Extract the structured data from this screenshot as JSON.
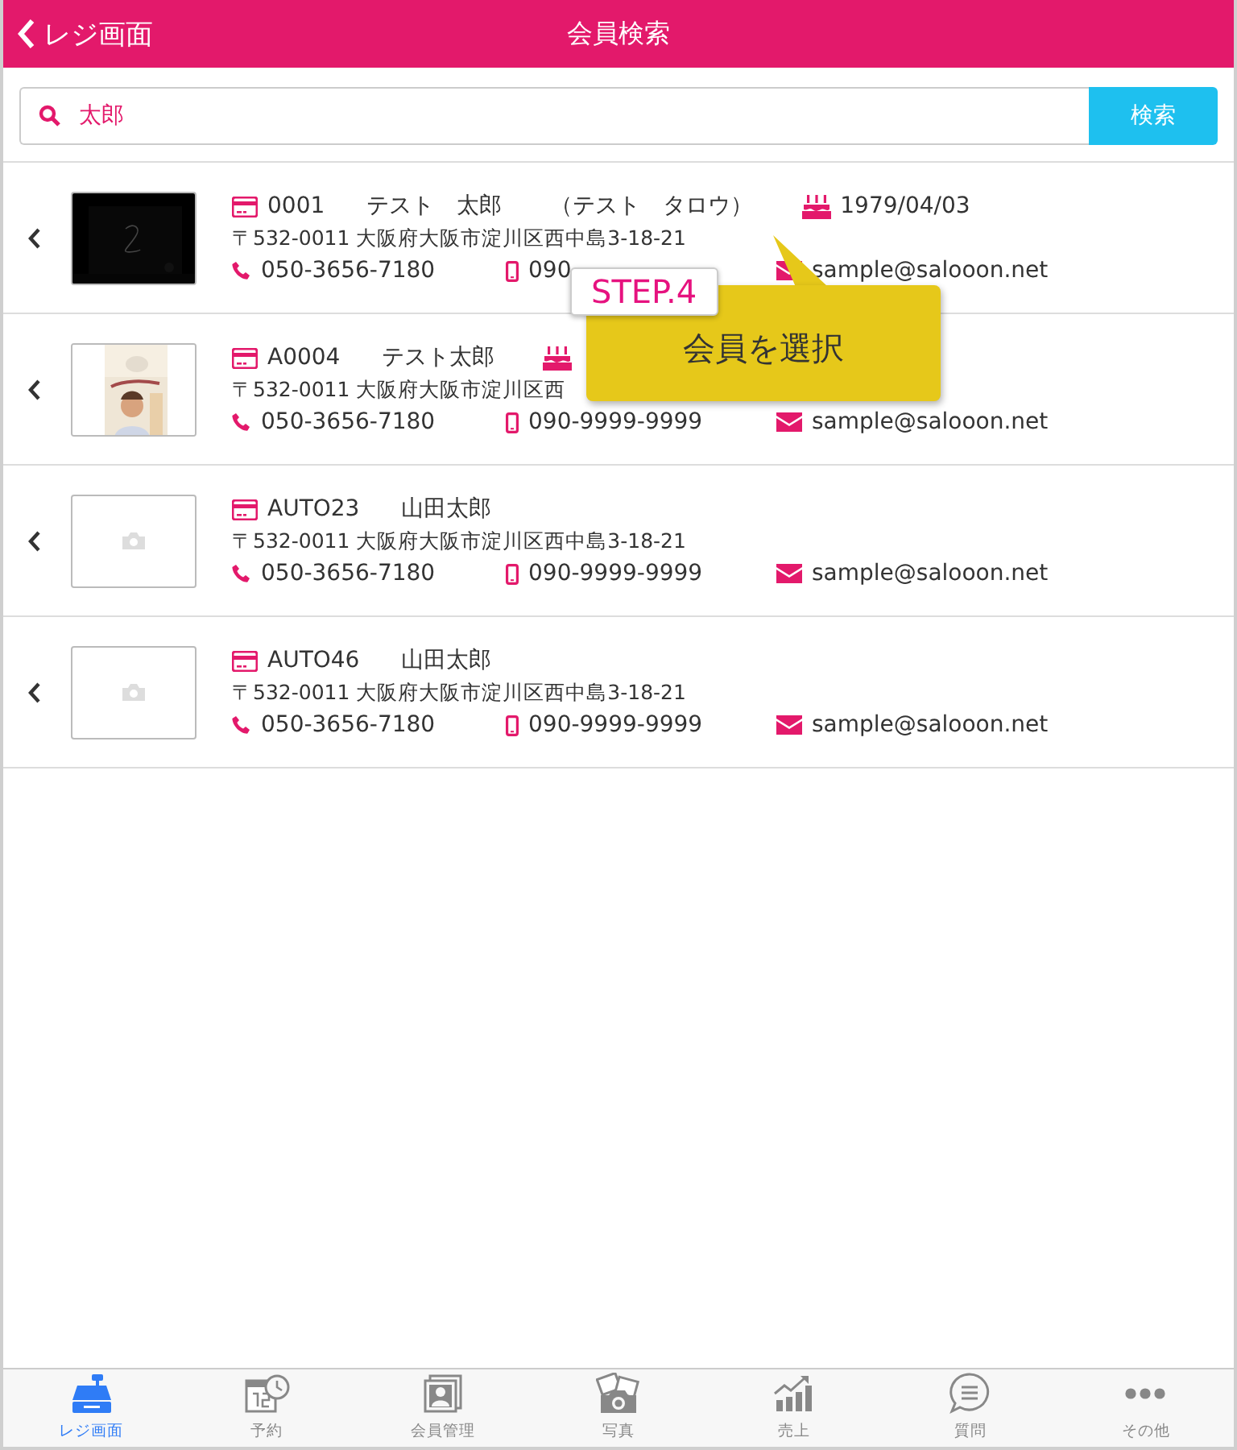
{
  "header": {
    "back_label": "レジ画面",
    "title": "会員検索"
  },
  "search": {
    "value": "太郎",
    "button": "検索"
  },
  "members": [
    {
      "code": "0001",
      "name": "テスト　太郎",
      "kana": "（テスト　タロウ）",
      "birthday_shown": true,
      "birthday": "1979/04/03",
      "address": "〒532-0011 大阪府大阪市淀川区西中島3-18-21",
      "phone": "050-3656-7180",
      "mobile": "090",
      "email": "sample@salooon.net"
    },
    {
      "code": "A0004",
      "name": "テスト太郎",
      "birthday_shown": true,
      "address": "〒532-0011 大阪府大阪市淀川区西",
      "phone": "050-3656-7180",
      "mobile": "090-9999-9999",
      "email": "sample@salooon.net"
    },
    {
      "photo": {
        "kind": "placeholder"
      },
      "code": "AUTO23",
      "name": "山田太郎",
      "birthday_shown": false,
      "address": "〒532-0011 大阪府大阪市淀川区西中島3-18-21",
      "phone": "050-3656-7180",
      "mobile": "090-9999-9999",
      "email": "sample@salooon.net"
    },
    {
      "photo": {
        "kind": "placeholder"
      },
      "code": "AUTO46",
      "name": "山田太郎",
      "birthday_shown": false,
      "address": "〒532-0011 大阪府大阪市淀川区西中島3-18-21",
      "phone": "050-3656-7180",
      "mobile": "090-9999-9999",
      "email": "sample@salooon.net"
    }
  ],
  "callout": {
    "step": "STEP.4",
    "text": "会員を選択"
  },
  "tabs": [
    {
      "kind": "register",
      "label": "レジ画面",
      "selected": true
    },
    {
      "kind": "calendar",
      "label": "予約",
      "selected": false
    },
    {
      "kind": "member",
      "label": "会員管理",
      "selected": false
    },
    {
      "kind": "camera",
      "label": "写真",
      "selected": false
    },
    {
      "kind": "chart",
      "label": "売上",
      "selected": false
    },
    {
      "kind": "chat",
      "label": "質問",
      "selected": false
    },
    {
      "kind": "more",
      "label": "その他",
      "selected": false
    }
  ]
}
